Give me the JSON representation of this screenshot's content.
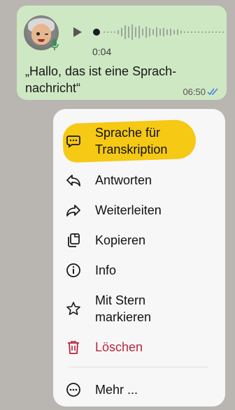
{
  "message": {
    "duration": "0:04",
    "text": "„Hallo, das ist eine Sprach­nachricht“",
    "text_line1": "„Hallo, das ist eine Sprach-",
    "text_line2": "nachricht“",
    "time": "06:50",
    "status": "read"
  },
  "menu": {
    "items": [
      {
        "label_line1": "Sprache für",
        "label_line2": "Transkription",
        "icon": "speech-bubble-icon"
      },
      {
        "label": "Antworten",
        "icon": "reply-icon"
      },
      {
        "label": "Weiterleiten",
        "icon": "forward-icon"
      },
      {
        "label": "Kopieren",
        "icon": "copy-icon"
      },
      {
        "label": "Info",
        "icon": "info-icon"
      },
      {
        "label_line1": "Mit Stern",
        "label_line2": "markieren",
        "icon": "star-icon"
      },
      {
        "label": "Löschen",
        "icon": "trash-icon"
      },
      {
        "label": "Mehr ...",
        "icon": "more-icon"
      }
    ]
  },
  "colors": {
    "bubble": "#cfe8c4",
    "highlight": "#f4c400",
    "danger": "#b8253d",
    "read_ticks": "#3a7be0"
  }
}
